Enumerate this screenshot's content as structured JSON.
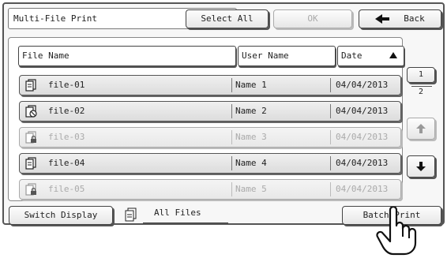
{
  "header": {
    "title": "Multi-File Print",
    "select_all_label": "Select All",
    "ok_label": "OK",
    "back_label": "Back"
  },
  "columns": {
    "file_name": "File Name",
    "user_name": "User Name",
    "date": "Date"
  },
  "rows": [
    {
      "file": "file-01",
      "user": "Name 1",
      "date": "04/04/2013",
      "enabled": true
    },
    {
      "file": "file-02",
      "user": "Name 2",
      "date": "04/04/2013",
      "enabled": true
    },
    {
      "file": "file-03",
      "user": "Name 3",
      "date": "04/04/2013",
      "enabled": false
    },
    {
      "file": "file-04",
      "user": "Name 4",
      "date": "04/04/2013",
      "enabled": true
    },
    {
      "file": "file-05",
      "user": "Name 5",
      "date": "04/04/2013",
      "enabled": false
    }
  ],
  "pager": {
    "current_page": "1",
    "total_pages": "2"
  },
  "footer": {
    "switch_display_label": "Switch Display",
    "filter_label": "All Files",
    "batch_print_label": "Batch Print"
  },
  "icons": {
    "back": "left-arrow-icon",
    "sort": "sort-ascending-icon",
    "row_file": "document-icon",
    "row_file_prohibited": "document-prohibited-icon",
    "row_file_locked": "document-locked-icon",
    "page_up": "up-arrow-icon",
    "page_down": "down-arrow-icon",
    "all_files": "file-stack-icon",
    "pointer": "hand-pointer-icon"
  }
}
